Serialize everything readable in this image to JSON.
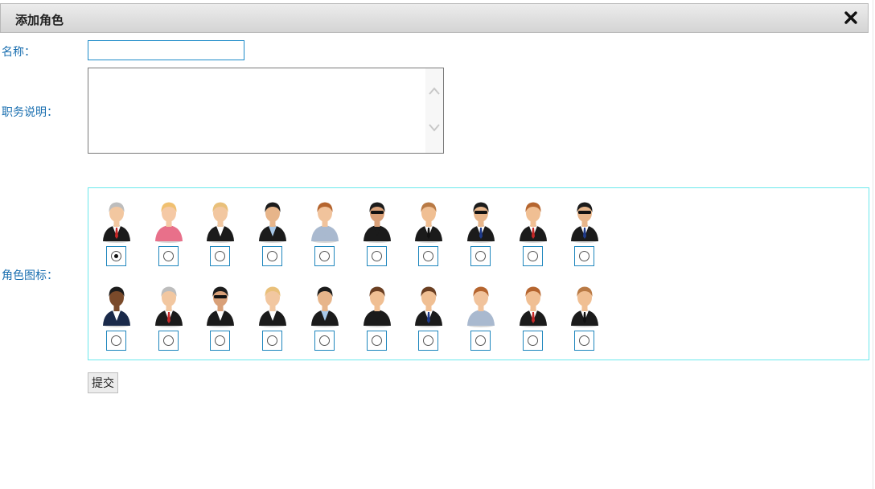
{
  "dialog": {
    "title": "添加角色",
    "close_icon": "close-icon"
  },
  "form": {
    "name_label": "名称：",
    "name_value": "",
    "desc_label": "职务说明：",
    "desc_value": "",
    "icon_label": "角色图标：",
    "submit_label": "提交"
  },
  "icons": {
    "selected_index": 0,
    "row1": [
      {
        "name": "avatar-gray-hair-man",
        "hair": "#bdbdbd",
        "skin": "#f2c7a0",
        "suit": "#1b1b1b",
        "shirt": "#ffffff",
        "tie": "#c62828",
        "glasses": false
      },
      {
        "name": "avatar-blonde-woman-pink",
        "hair": "#f0c070",
        "skin": "#f5c9a5",
        "suit": "#e8708a",
        "shirt": "#e8708a",
        "tie": "",
        "glasses": false
      },
      {
        "name": "avatar-blonde-woman-suit",
        "hair": "#e9c07a",
        "skin": "#f2c7a0",
        "suit": "#1b1b1b",
        "shirt": "#ffffff",
        "tie": "",
        "glasses": false
      },
      {
        "name": "avatar-man-black-hair",
        "hair": "#1c1c1c",
        "skin": "#e7b58a",
        "suit": "#1b1b1b",
        "shirt": "#a8c8e8",
        "tie": "",
        "glasses": false
      },
      {
        "name": "avatar-woman-brown-hair",
        "hair": "#b5652f",
        "skin": "#f1c39c",
        "suit": "#a9b9cf",
        "shirt": "#a9b9cf",
        "tie": "",
        "glasses": false
      },
      {
        "name": "avatar-woman-sunglasses",
        "hair": "#1c1c1c",
        "skin": "#d9a078",
        "suit": "#1b1b1b",
        "shirt": "#1b1b1b",
        "tie": "",
        "glasses": true
      },
      {
        "name": "avatar-man-bowtie",
        "hair": "#b97a45",
        "skin": "#f0bf93",
        "suit": "#1b1b1b",
        "shirt": "#ffffff",
        "tie": "#111111",
        "glasses": false
      },
      {
        "name": "avatar-agent-blue-tie",
        "hair": "#1c1c1c",
        "skin": "#e7b58a",
        "suit": "#1b1b1b",
        "shirt": "#ffffff",
        "tie": "#1e3a8a",
        "glasses": true
      },
      {
        "name": "avatar-man-red-tie",
        "hair": "#b5652f",
        "skin": "#f0bf93",
        "suit": "#1b1b1b",
        "shirt": "#ffffff",
        "tie": "#c62828",
        "glasses": false
      },
      {
        "name": "avatar-agent-sunglasses",
        "hair": "#1c1c1c",
        "skin": "#e7b58a",
        "suit": "#1b1b1b",
        "shirt": "#ffffff",
        "tie": "#1e3a8a",
        "glasses": true
      }
    ],
    "row2": [
      {
        "name": "avatar-dark-skin-woman",
        "hair": "#1c1c1c",
        "skin": "#7a4a2a",
        "suit": "#1a2a4a",
        "shirt": "#ffffff",
        "tie": "",
        "glasses": false
      },
      {
        "name": "avatar-gray-hair-man-2",
        "hair": "#bdbdbd",
        "skin": "#f2c7a0",
        "suit": "#1b1b1b",
        "shirt": "#ffffff",
        "tie": "#c62828",
        "glasses": false
      },
      {
        "name": "avatar-woman-sunglasses-2",
        "hair": "#1c1c1c",
        "skin": "#d9a078",
        "suit": "#1b1b1b",
        "shirt": "#ffffff",
        "tie": "",
        "glasses": true
      },
      {
        "name": "avatar-blonde-woman-suit-2",
        "hair": "#e9c07a",
        "skin": "#f2c7a0",
        "suit": "#1b1b1b",
        "shirt": "#ffffff",
        "tie": "",
        "glasses": false
      },
      {
        "name": "avatar-man-black-hair-2",
        "hair": "#1c1c1c",
        "skin": "#e7b58a",
        "suit": "#1b1b1b",
        "shirt": "#a8c8e8",
        "tie": "",
        "glasses": false
      },
      {
        "name": "avatar-woman-headset",
        "hair": "#6b3f22",
        "skin": "#f0bf93",
        "suit": "#1b1b1b",
        "shirt": "#1b1b1b",
        "tie": "",
        "glasses": false
      },
      {
        "name": "avatar-man-headset",
        "hair": "#6b3f22",
        "skin": "#f0bf93",
        "suit": "#1b1b1b",
        "shirt": "#ffffff",
        "tie": "#1e3a8a",
        "glasses": false
      },
      {
        "name": "avatar-woman-brown-hair-2",
        "hair": "#b5652f",
        "skin": "#f1c39c",
        "suit": "#a9b9cf",
        "shirt": "#a9b9cf",
        "tie": "",
        "glasses": false
      },
      {
        "name": "avatar-man-red-tie-2",
        "hair": "#b5652f",
        "skin": "#f0bf93",
        "suit": "#1b1b1b",
        "shirt": "#ffffff",
        "tie": "#c62828",
        "glasses": false
      },
      {
        "name": "avatar-man-bowtie-2",
        "hair": "#b97a45",
        "skin": "#f0bf93",
        "suit": "#1b1b1b",
        "shirt": "#ffffff",
        "tie": "#111111",
        "glasses": false
      }
    ]
  }
}
